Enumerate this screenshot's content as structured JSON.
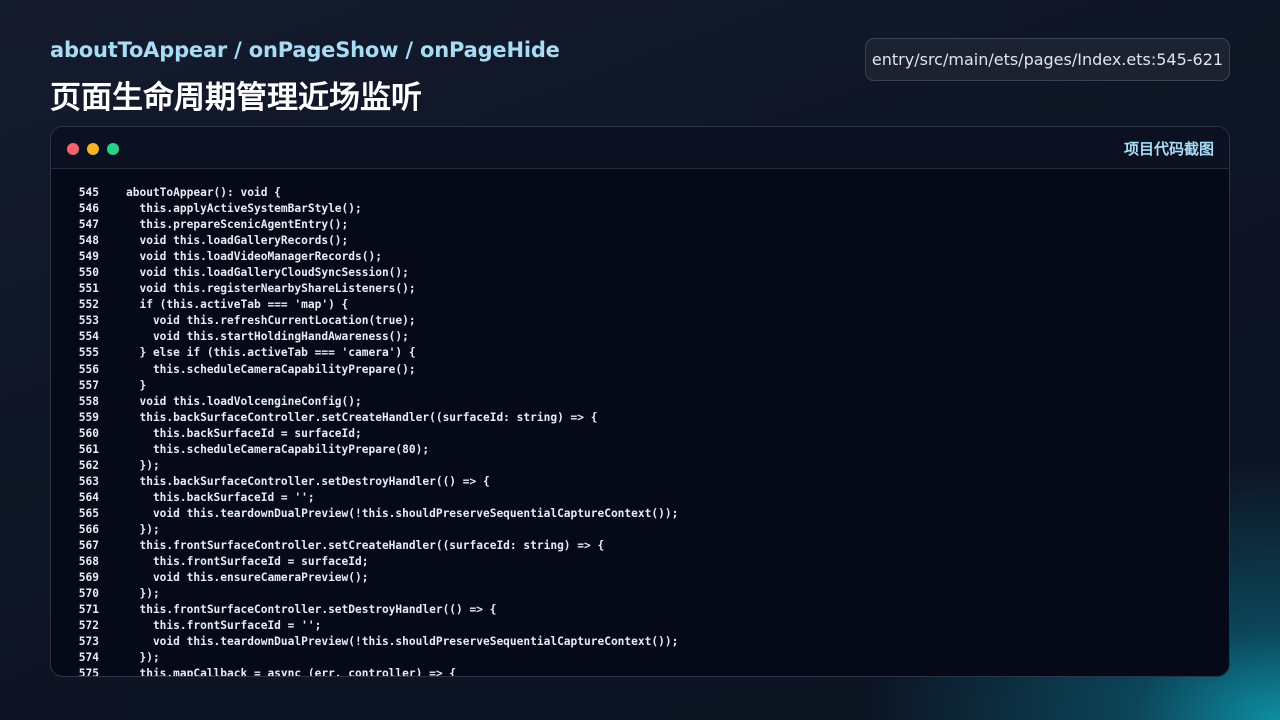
{
  "header": {
    "subtitle": "aboutToAppear / onPageShow / onPageHide",
    "title": "页面生命周期管理近场监听",
    "file_path": "entry/src/main/ets/pages/Index.ets:545-621"
  },
  "window": {
    "label": "项目代码截图",
    "controls": [
      "close-dot",
      "minimize-dot",
      "maximize-dot"
    ]
  },
  "code_lines": [
    {
      "n": "545",
      "t": "aboutToAppear(): void {"
    },
    {
      "n": "546",
      "t": "  this.applyActiveSystemBarStyle();"
    },
    {
      "n": "547",
      "t": "  this.prepareScenicAgentEntry();"
    },
    {
      "n": "548",
      "t": "  void this.loadGalleryRecords();"
    },
    {
      "n": "549",
      "t": "  void this.loadVideoManagerRecords();"
    },
    {
      "n": "550",
      "t": "  void this.loadGalleryCloudSyncSession();"
    },
    {
      "n": "551",
      "t": "  void this.registerNearbyShareListeners();"
    },
    {
      "n": "552",
      "t": "  if (this.activeTab === 'map') {"
    },
    {
      "n": "553",
      "t": "    void this.refreshCurrentLocation(true);"
    },
    {
      "n": "554",
      "t": "    void this.startHoldingHandAwareness();"
    },
    {
      "n": "555",
      "t": "  } else if (this.activeTab === 'camera') {"
    },
    {
      "n": "556",
      "t": "    this.scheduleCameraCapabilityPrepare();"
    },
    {
      "n": "557",
      "t": "  }"
    },
    {
      "n": "558",
      "t": "  void this.loadVolcengineConfig();"
    },
    {
      "n": "559",
      "t": "  this.backSurfaceController.setCreateHandler((surfaceId: string) => {"
    },
    {
      "n": "560",
      "t": "    this.backSurfaceId = surfaceId;"
    },
    {
      "n": "561",
      "t": "    this.scheduleCameraCapabilityPrepare(80);"
    },
    {
      "n": "562",
      "t": "  });"
    },
    {
      "n": "563",
      "t": "  this.backSurfaceController.setDestroyHandler(() => {"
    },
    {
      "n": "564",
      "t": "    this.backSurfaceId = '';"
    },
    {
      "n": "565",
      "t": "    void this.teardownDualPreview(!this.shouldPreserveSequentialCaptureContext());"
    },
    {
      "n": "566",
      "t": "  });"
    },
    {
      "n": "567",
      "t": "  this.frontSurfaceController.setCreateHandler((surfaceId: string) => {"
    },
    {
      "n": "568",
      "t": "    this.frontSurfaceId = surfaceId;"
    },
    {
      "n": "569",
      "t": "    void this.ensureCameraPreview();"
    },
    {
      "n": "570",
      "t": "  });"
    },
    {
      "n": "571",
      "t": "  this.frontSurfaceController.setDestroyHandler(() => {"
    },
    {
      "n": "572",
      "t": "    this.frontSurfaceId = '';"
    },
    {
      "n": "573",
      "t": "    void this.teardownDualPreview(!this.shouldPreserveSequentialCaptureContext());"
    },
    {
      "n": "574",
      "t": "  });"
    },
    {
      "n": "575",
      "t": "  this.mapCallback = async (err, controller) => {"
    }
  ]
}
